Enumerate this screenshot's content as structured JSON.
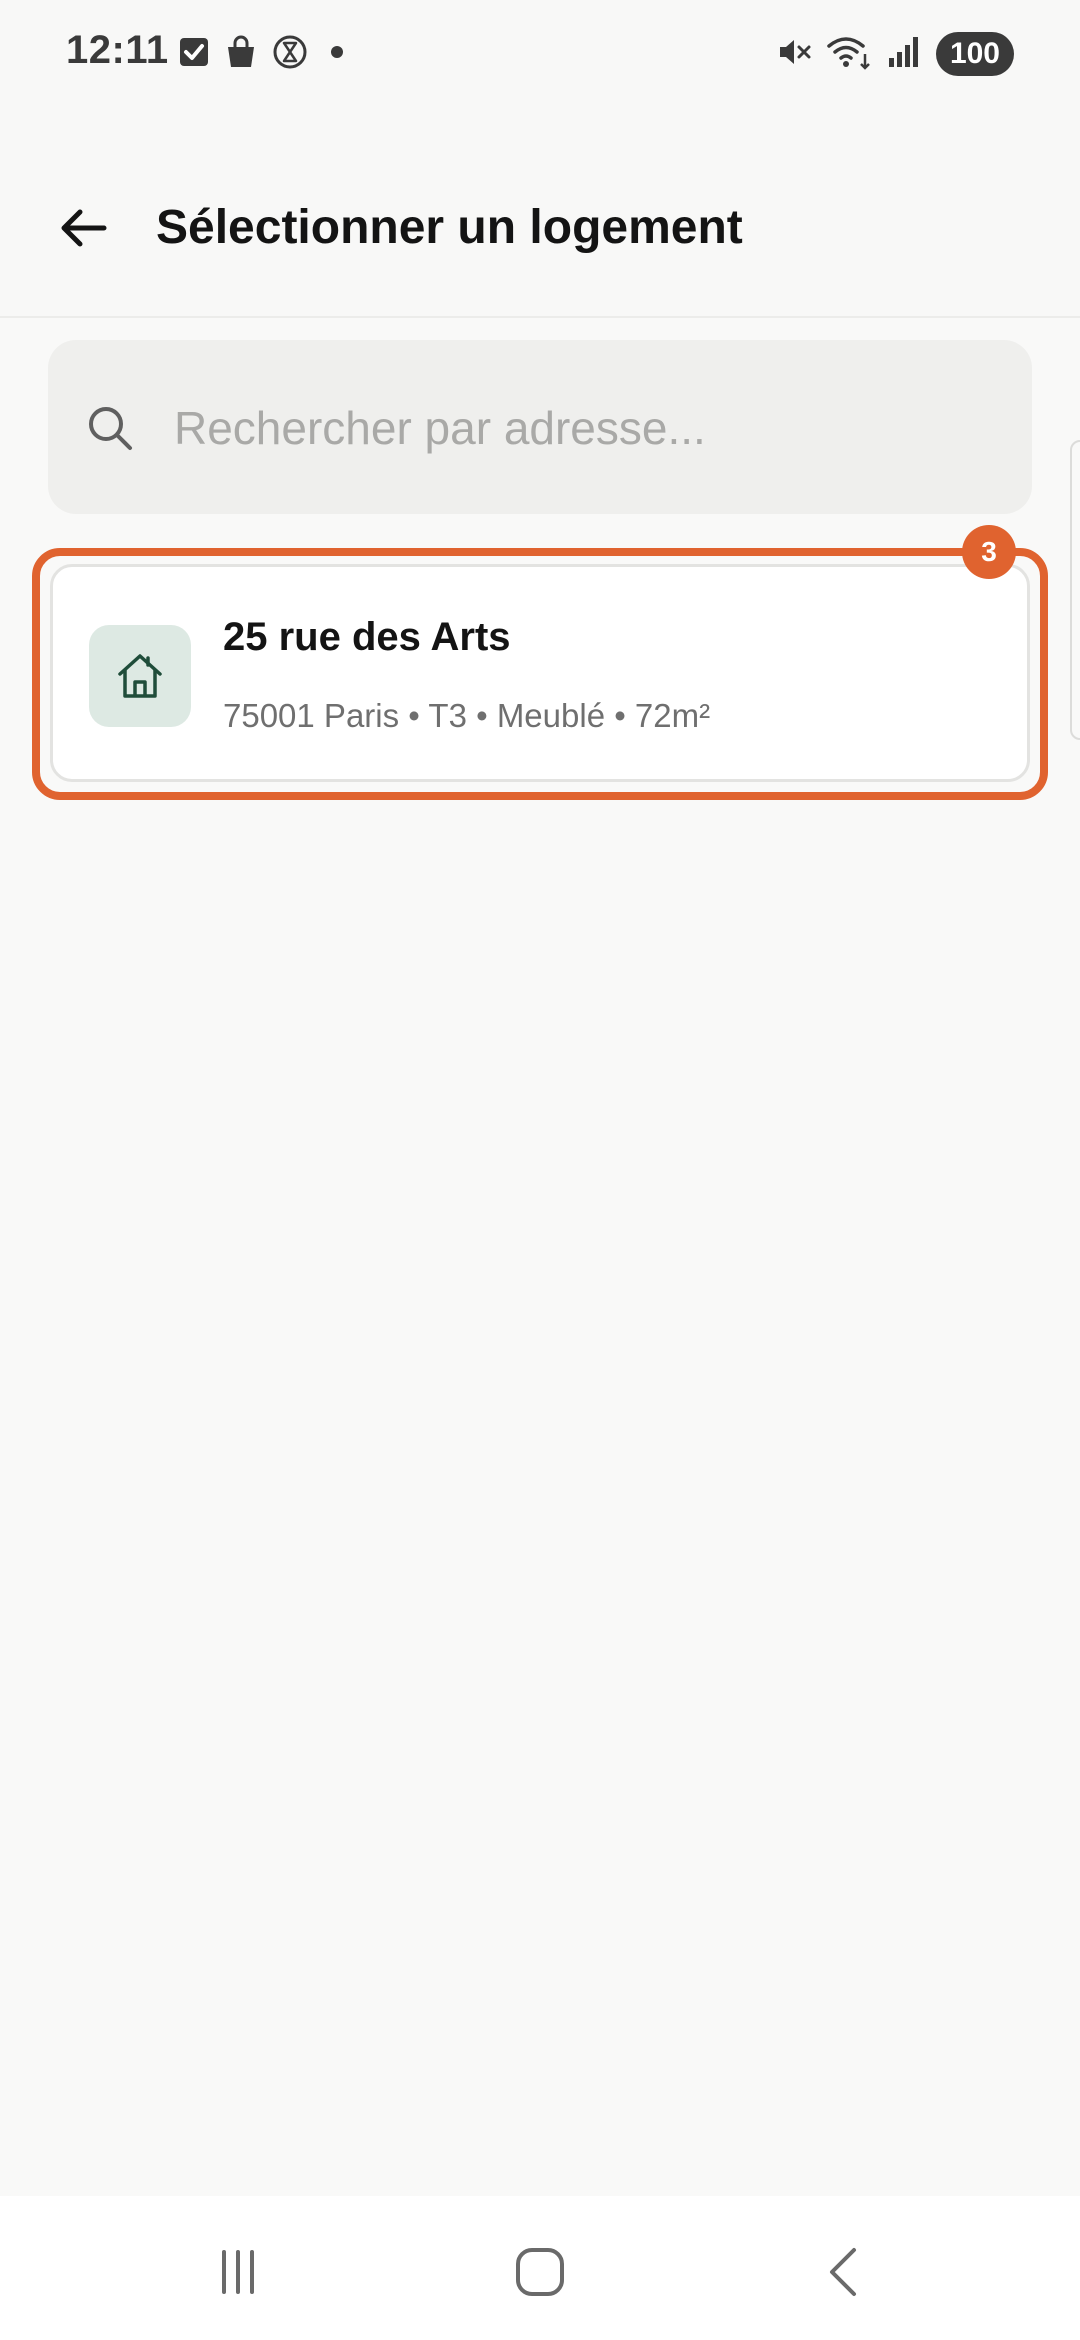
{
  "status_bar": {
    "time": "12:11",
    "left_icons": [
      "checkbox-icon",
      "shopping-bag-icon",
      "hourglass-icon",
      "dot-icon"
    ],
    "right_icons": [
      "mute-icon",
      "wifi-icon",
      "signal-icon"
    ],
    "battery": "100"
  },
  "header": {
    "back_icon": "arrow-left-icon",
    "title": "Sélectionner un logement"
  },
  "search": {
    "icon": "search-icon",
    "placeholder": "Rechercher par adresse...",
    "value": ""
  },
  "highlight": {
    "badge": "3",
    "color": "#e0632f"
  },
  "properties": [
    {
      "icon": "home-icon",
      "title": "25 rue des Arts",
      "meta": "75001 Paris • T3 • Meublé • 72m²"
    }
  ],
  "nav_bar": {
    "buttons": [
      "recent-apps-icon",
      "home-button-icon",
      "back-chevron-icon"
    ]
  },
  "colors": {
    "accent": "#e0632f",
    "icon_tile": "#dde9e3",
    "icon_stroke": "#1f4d3a",
    "background": "#f9f9f8"
  }
}
